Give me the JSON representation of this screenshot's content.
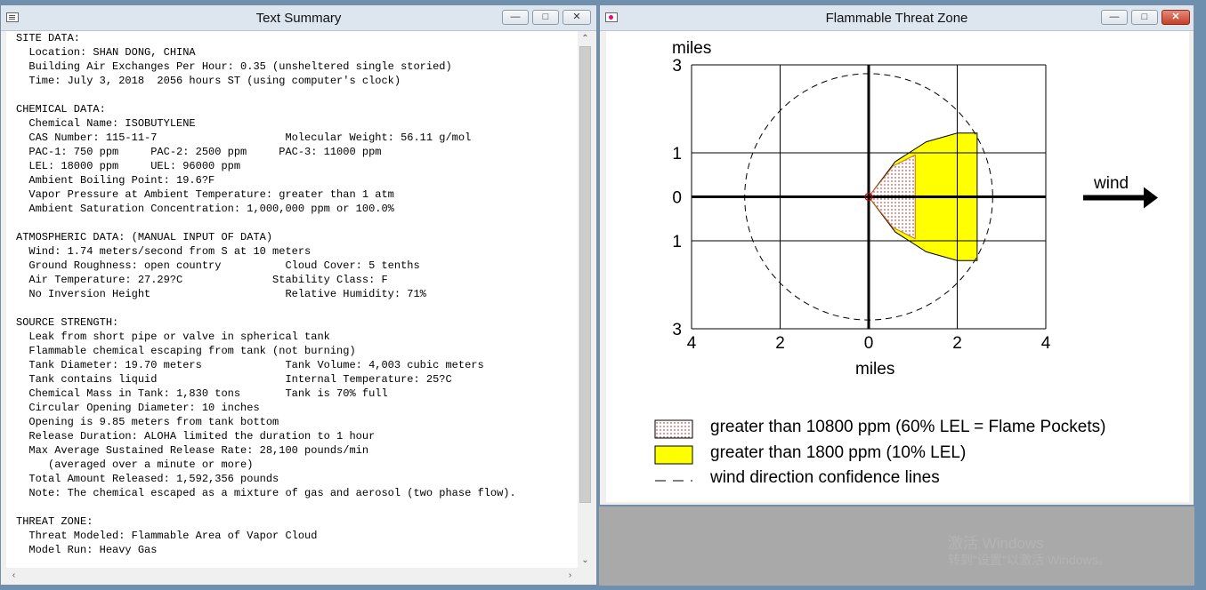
{
  "text_window": {
    "title": "Text Summary",
    "lines": [
      "SITE DATA:",
      "  Location: SHAN DONG, CHINA",
      "  Building Air Exchanges Per Hour: 0.35 (unsheltered single storied)",
      "  Time: July 3, 2018  2056 hours ST (using computer's clock)",
      "",
      "CHEMICAL DATA:",
      "  Chemical Name: ISOBUTYLENE",
      "  CAS Number: 115-11-7                    Molecular Weight: 56.11 g/mol",
      "  PAC-1: 750 ppm     PAC-2: 2500 ppm     PAC-3: 11000 ppm",
      "  LEL: 18000 ppm     UEL: 96000 ppm",
      "  Ambient Boiling Point: 19.6?F",
      "  Vapor Pressure at Ambient Temperature: greater than 1 atm",
      "  Ambient Saturation Concentration: 1,000,000 ppm or 100.0%",
      "",
      "ATMOSPHERIC DATA: (MANUAL INPUT OF DATA)",
      "  Wind: 1.74 meters/second from S at 10 meters",
      "  Ground Roughness: open country          Cloud Cover: 5 tenths",
      "  Air Temperature: 27.29?C              Stability Class: F",
      "  No Inversion Height                     Relative Humidity: 71%",
      "",
      "SOURCE STRENGTH:",
      "  Leak from short pipe or valve in spherical tank",
      "  Flammable chemical escaping from tank (not burning)",
      "  Tank Diameter: 19.70 meters             Tank Volume: 4,003 cubic meters",
      "  Tank contains liquid                    Internal Temperature: 25?C",
      "  Chemical Mass in Tank: 1,830 tons       Tank is 70% full",
      "  Circular Opening Diameter: 10 inches",
      "  Opening is 9.85 meters from tank bottom",
      "  Release Duration: ALOHA limited the duration to 1 hour",
      "  Max Average Sustained Release Rate: 28,100 pounds/min",
      "     (averaged over a minute or more)",
      "  Total Amount Released: 1,592,356 pounds",
      "  Note: The chemical escaped as a mixture of gas and aerosol (two phase flow).",
      "",
      "THREAT ZONE:",
      "  Threat Modeled: Flammable Area of Vapor Cloud",
      "  Model Run: Heavy Gas"
    ]
  },
  "threat_window": {
    "title": "Flammable Threat Zone",
    "y_unit": "miles",
    "x_unit": "miles",
    "wind_label": "wind",
    "legend": [
      {
        "label": "greater than 10800 ppm (60% LEL = Flame Pockets)",
        "swatch": "red-dotted",
        "color": "#c00000"
      },
      {
        "label": "greater than 1800 ppm (10% LEL)",
        "swatch": "yellow",
        "color": "#ffff00"
      },
      {
        "label": "wind direction confidence lines",
        "swatch": "dashed"
      }
    ]
  },
  "chart_data": {
    "type": "area",
    "x_ticks": [
      "4",
      "2",
      "0",
      "2",
      "4"
    ],
    "y_ticks": [
      "3",
      "1",
      "0",
      "1",
      "3"
    ],
    "xlim": [
      -4,
      4
    ],
    "ylim": [
      -3,
      3
    ],
    "xlabel": "miles",
    "ylabel": "miles",
    "grid": true,
    "confidence_circle_radius": 2.8,
    "series": [
      {
        "name": "greater than 1800 ppm (10% LEL)",
        "color": "#ffff00",
        "outline": [
          [
            0,
            0
          ],
          [
            0.6,
            0.8
          ],
          [
            1.3,
            1.25
          ],
          [
            2.0,
            1.45
          ],
          [
            2.45,
            1.45
          ],
          [
            2.45,
            -1.45
          ],
          [
            2.0,
            -1.45
          ],
          [
            1.3,
            -1.25
          ],
          [
            0.6,
            -0.8
          ],
          [
            0,
            0
          ]
        ]
      },
      {
        "name": "greater than 10800 ppm (60% LEL = Flame Pockets)",
        "color": "#c00000",
        "outline": [
          [
            0,
            0
          ],
          [
            0.55,
            0.7
          ],
          [
            1.05,
            0.95
          ],
          [
            1.05,
            -0.95
          ],
          [
            0.55,
            -0.7
          ],
          [
            0,
            0
          ]
        ]
      }
    ]
  },
  "watermark": {
    "line1": "激活 Windows",
    "line2": "转到\"设置\"以激活 Windows。"
  }
}
